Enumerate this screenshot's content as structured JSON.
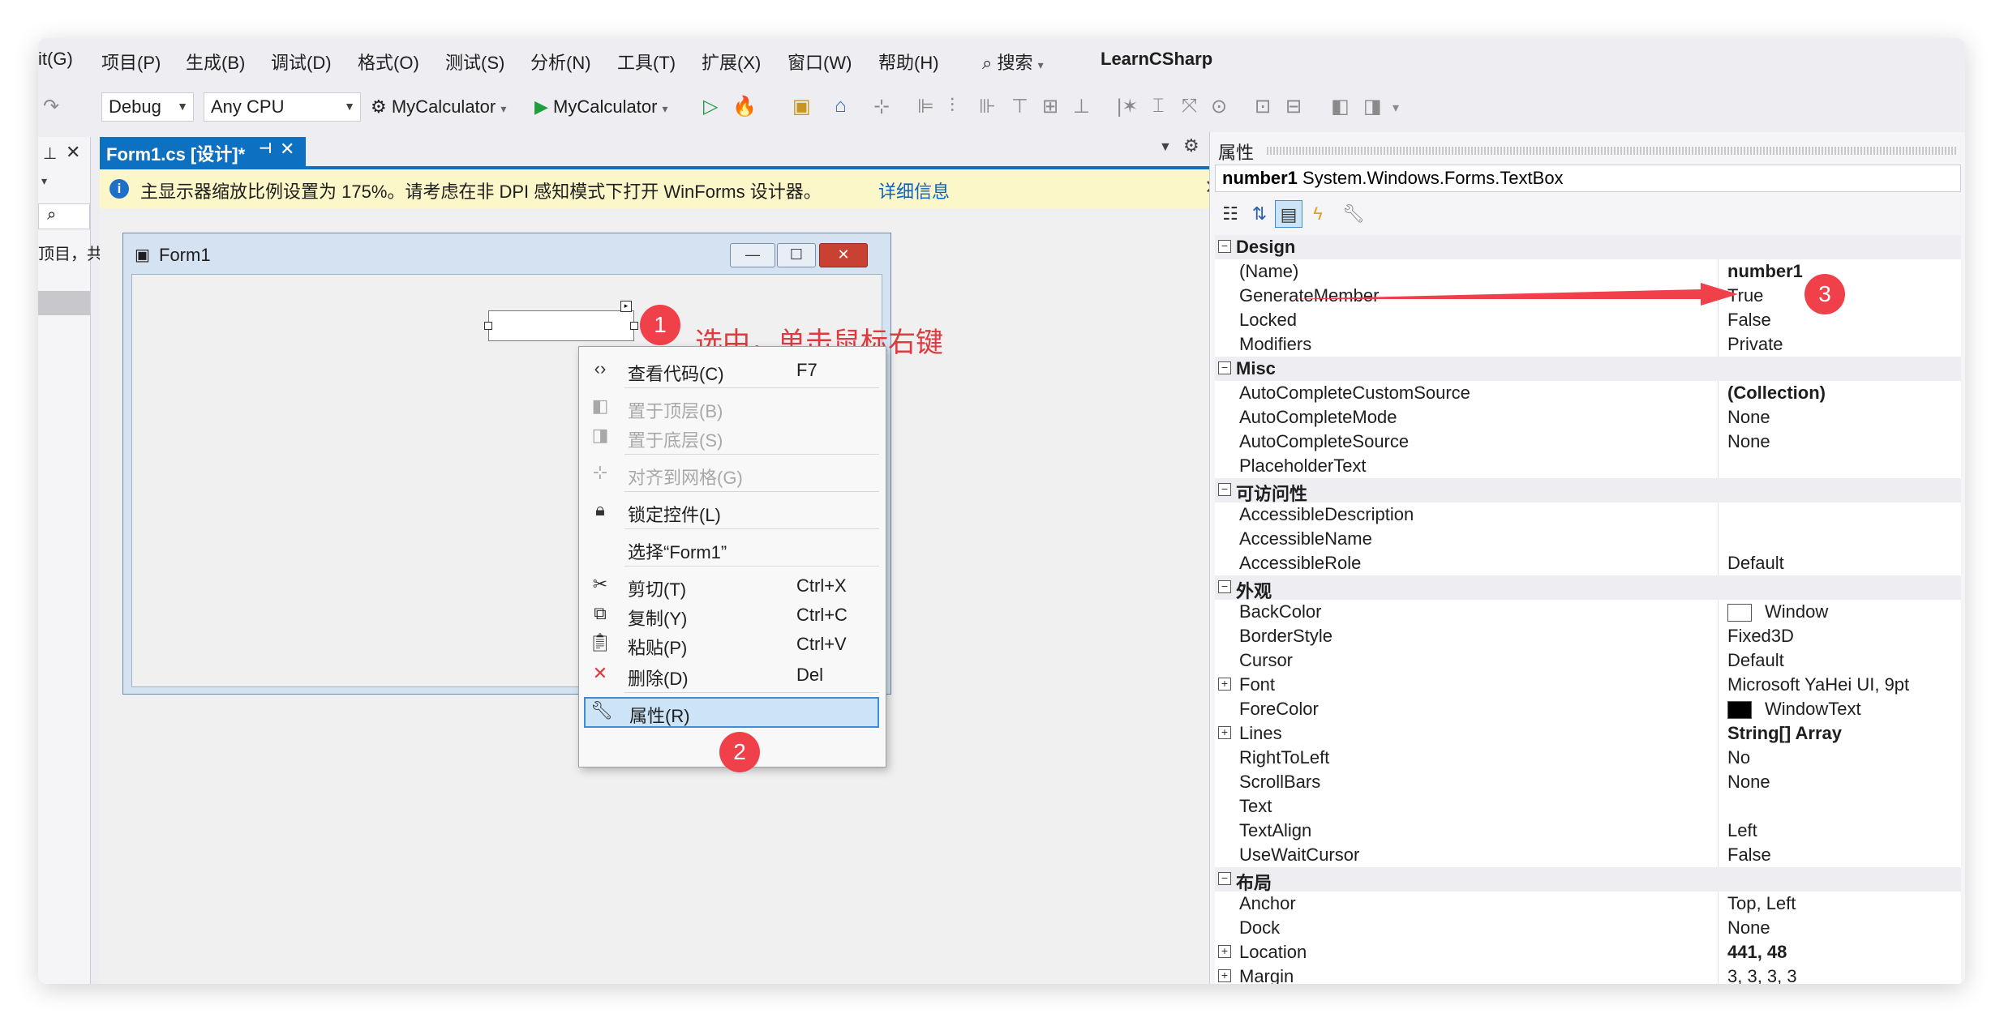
{
  "menu": [
    "it(G)",
    "项目(P)",
    "生成(B)",
    "调试(D)",
    "格式(O)",
    "测试(S)",
    "分析(N)",
    "工具(T)",
    "扩展(X)",
    "窗口(W)",
    "帮助(H)"
  ],
  "search_label": "搜索",
  "app_title": "LearnCSharp",
  "toolbar": {
    "config": "Debug",
    "platform": "Any CPU",
    "startup_project": "MyCalculator",
    "run_label": "MyCalculator"
  },
  "left_panel": {
    "text": "顶目，共"
  },
  "doc_tab": {
    "label": "Form1.cs [设计]*"
  },
  "infobar": {
    "message": "主显示器缩放比例设置为 175%。请考虑在非 DPI 感知模式下打开 WinForms 设计器。",
    "link": "详细信息"
  },
  "form": {
    "title": "Form1"
  },
  "context_menu": [
    {
      "label": "查看代码(C)",
      "shortcut": "F7",
      "icon": "code-icon",
      "disabled": false
    },
    {
      "label": "置于顶层(B)",
      "shortcut": "",
      "icon": "bring-to-front-icon",
      "disabled": true
    },
    {
      "label": "置于底层(S)",
      "shortcut": "",
      "icon": "send-to-back-icon",
      "disabled": true
    },
    {
      "label": "对齐到网格(G)",
      "shortcut": "",
      "icon": "align-grid-icon",
      "disabled": true
    },
    {
      "label": "锁定控件(L)",
      "shortcut": "",
      "icon": "lock-icon",
      "disabled": false
    },
    {
      "label": "选择“Form1”",
      "shortcut": "",
      "icon": "",
      "disabled": false
    },
    {
      "label": "剪切(T)",
      "shortcut": "Ctrl+X",
      "icon": "cut-icon",
      "disabled": false
    },
    {
      "label": "复制(Y)",
      "shortcut": "Ctrl+C",
      "icon": "copy-icon",
      "disabled": false
    },
    {
      "label": "粘贴(P)",
      "shortcut": "Ctrl+V",
      "icon": "paste-icon",
      "disabled": false
    },
    {
      "label": "删除(D)",
      "shortcut": "Del",
      "icon": "delete-icon",
      "disabled": false
    },
    {
      "label": "属性(R)",
      "shortcut": "",
      "icon": "wrench-icon",
      "disabled": false
    }
  ],
  "callouts": {
    "step1": "1",
    "step1_text": "选中，单击鼠标右键",
    "step2": "2",
    "step3": "3",
    "accent": "#f0404a"
  },
  "properties": {
    "header": "属性",
    "object_name": "number1",
    "object_type": "System.Windows.Forms.TextBox",
    "rows": [
      {
        "kind": "cat",
        "name": "Design"
      },
      {
        "kind": "prop",
        "name": "(Name)",
        "value": "number1",
        "bold": true
      },
      {
        "kind": "prop",
        "name": "GenerateMember",
        "value": "True"
      },
      {
        "kind": "prop",
        "name": "Locked",
        "value": "False"
      },
      {
        "kind": "prop",
        "name": "Modifiers",
        "value": "Private"
      },
      {
        "kind": "cat",
        "name": "Misc"
      },
      {
        "kind": "prop",
        "name": "AutoCompleteCustomSource",
        "value": "(Collection)",
        "bold": true
      },
      {
        "kind": "prop",
        "name": "AutoCompleteMode",
        "value": "None"
      },
      {
        "kind": "prop",
        "name": "AutoCompleteSource",
        "value": "None"
      },
      {
        "kind": "prop",
        "name": "PlaceholderText",
        "value": ""
      },
      {
        "kind": "cat",
        "name": "可访问性"
      },
      {
        "kind": "prop",
        "name": "AccessibleDescription",
        "value": ""
      },
      {
        "kind": "prop",
        "name": "AccessibleName",
        "value": ""
      },
      {
        "kind": "prop",
        "name": "AccessibleRole",
        "value": "Default"
      },
      {
        "kind": "cat",
        "name": "外观"
      },
      {
        "kind": "prop",
        "name": "BackColor",
        "value": "Window",
        "swatch": "#ffffff"
      },
      {
        "kind": "prop",
        "name": "BorderStyle",
        "value": "Fixed3D"
      },
      {
        "kind": "prop",
        "name": "Cursor",
        "value": "Default"
      },
      {
        "kind": "prop",
        "name": "Font",
        "value": "Microsoft YaHei UI, 9pt",
        "expand": true
      },
      {
        "kind": "prop",
        "name": "ForeColor",
        "value": "WindowText",
        "swatch": "#000000"
      },
      {
        "kind": "prop",
        "name": "Lines",
        "value": "String[] Array",
        "bold": true,
        "expand": true
      },
      {
        "kind": "prop",
        "name": "RightToLeft",
        "value": "No"
      },
      {
        "kind": "prop",
        "name": "ScrollBars",
        "value": "None"
      },
      {
        "kind": "prop",
        "name": "Text",
        "value": ""
      },
      {
        "kind": "prop",
        "name": "TextAlign",
        "value": "Left"
      },
      {
        "kind": "prop",
        "name": "UseWaitCursor",
        "value": "False"
      },
      {
        "kind": "cat",
        "name": "布局"
      },
      {
        "kind": "prop",
        "name": "Anchor",
        "value": "Top, Left"
      },
      {
        "kind": "prop",
        "name": "Dock",
        "value": "None"
      },
      {
        "kind": "prop",
        "name": "Location",
        "value": "441, 48",
        "bold": true,
        "expand": true
      },
      {
        "kind": "prop",
        "name": "Margin",
        "value": "3, 3, 3, 3",
        "expand": true
      }
    ]
  }
}
